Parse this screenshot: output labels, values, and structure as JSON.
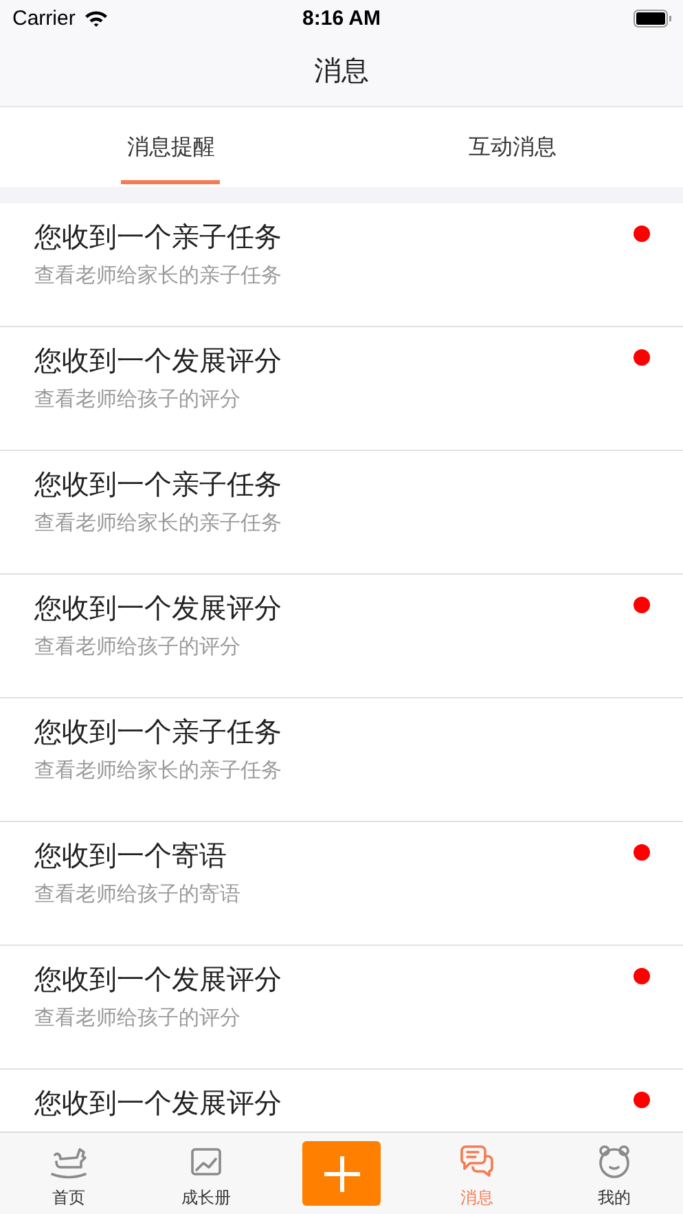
{
  "status_bar": {
    "carrier": "Carrier",
    "time": "8:16 AM"
  },
  "nav_bar": {
    "title": "消息"
  },
  "tabs": [
    {
      "label": "消息提醒",
      "selected": true
    },
    {
      "label": "互动消息",
      "selected": false
    }
  ],
  "messages": [
    {
      "title": "您收到一个亲子任务",
      "subtitle": "查看老师给家长的亲子任务",
      "unread": true
    },
    {
      "title": "您收到一个发展评分",
      "subtitle": "查看老师给孩子的评分",
      "unread": true
    },
    {
      "title": "您收到一个亲子任务",
      "subtitle": "查看老师给家长的亲子任务",
      "unread": false
    },
    {
      "title": "您收到一个发展评分",
      "subtitle": "查看老师给孩子的评分",
      "unread": true
    },
    {
      "title": "您收到一个亲子任务",
      "subtitle": "查看老师给家长的亲子任务",
      "unread": false
    },
    {
      "title": "您收到一个寄语",
      "subtitle": "查看老师给孩子的寄语",
      "unread": true
    },
    {
      "title": "您收到一个发展评分",
      "subtitle": "查看老师给孩子的评分",
      "unread": true
    },
    {
      "title": "您收到一个发展评分",
      "unread": true
    }
  ],
  "tab_bar": [
    {
      "kind": "tab",
      "label": "首页",
      "selected": false
    },
    {
      "kind": "tab",
      "label": "成长册",
      "selected": false
    },
    {
      "kind": "add"
    },
    {
      "kind": "tab",
      "label": "消息",
      "selected": true
    },
    {
      "kind": "tab",
      "label": "我的",
      "selected": false
    }
  ]
}
